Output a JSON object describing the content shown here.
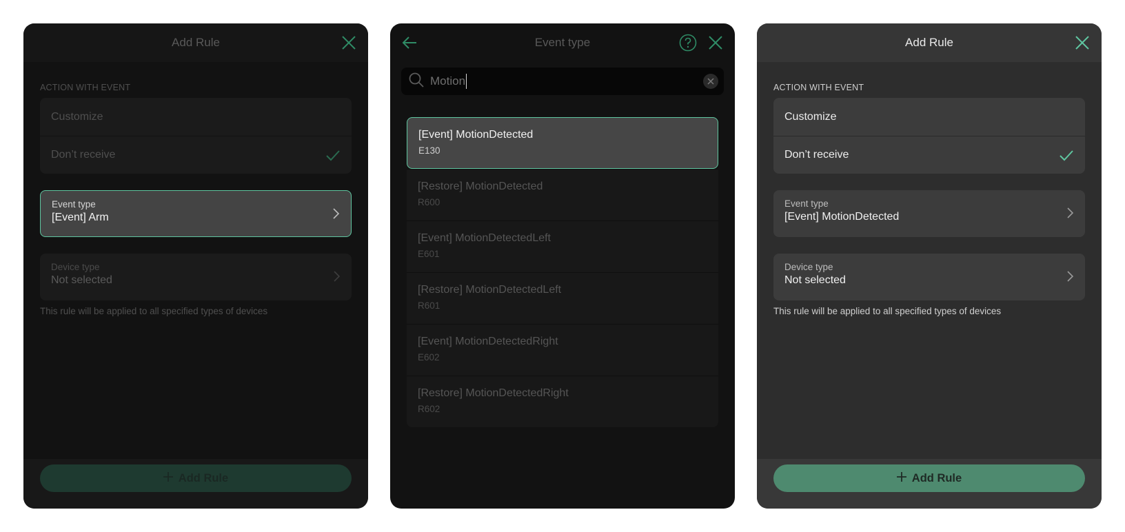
{
  "colors": {
    "accent": "#5fc6a0",
    "button_green": "#4e8a6f"
  },
  "panel1": {
    "title": "Add Rule",
    "section_label": "ACTION WITH EVENT",
    "options": [
      "Customize",
      "Don’t receive"
    ],
    "selected_option": "Don’t receive",
    "event_type": {
      "label": "Event type",
      "value": "[Event] Arm"
    },
    "device_type": {
      "label": "Device type",
      "value": "Not selected"
    },
    "hint": "This rule will be applied to all specified types of devices",
    "add_button": "Add Rule"
  },
  "panel2": {
    "title": "Event type",
    "search_value": "Motion",
    "results": [
      {
        "title": "[Event] MotionDetected",
        "code": "E130",
        "selected": true
      },
      {
        "title": "[Restore] MotionDetected",
        "code": "R600"
      },
      {
        "title": "[Event] MotionDetectedLeft",
        "code": "E601"
      },
      {
        "title": "[Restore] MotionDetectedLeft",
        "code": "R601"
      },
      {
        "title": "[Event] MotionDetectedRight",
        "code": "E602"
      },
      {
        "title": "[Restore] MotionDetectedRight",
        "code": "R602"
      }
    ]
  },
  "panel3": {
    "title": "Add Rule",
    "section_label": "ACTION WITH EVENT",
    "options": [
      "Customize",
      "Don’t receive"
    ],
    "selected_option": "Don’t receive",
    "event_type": {
      "label": "Event type",
      "value": "[Event] MotionDetected"
    },
    "device_type": {
      "label": "Device type",
      "value": "Not selected"
    },
    "hint": "This rule will be applied to all specified types of devices",
    "add_button": "Add Rule"
  }
}
